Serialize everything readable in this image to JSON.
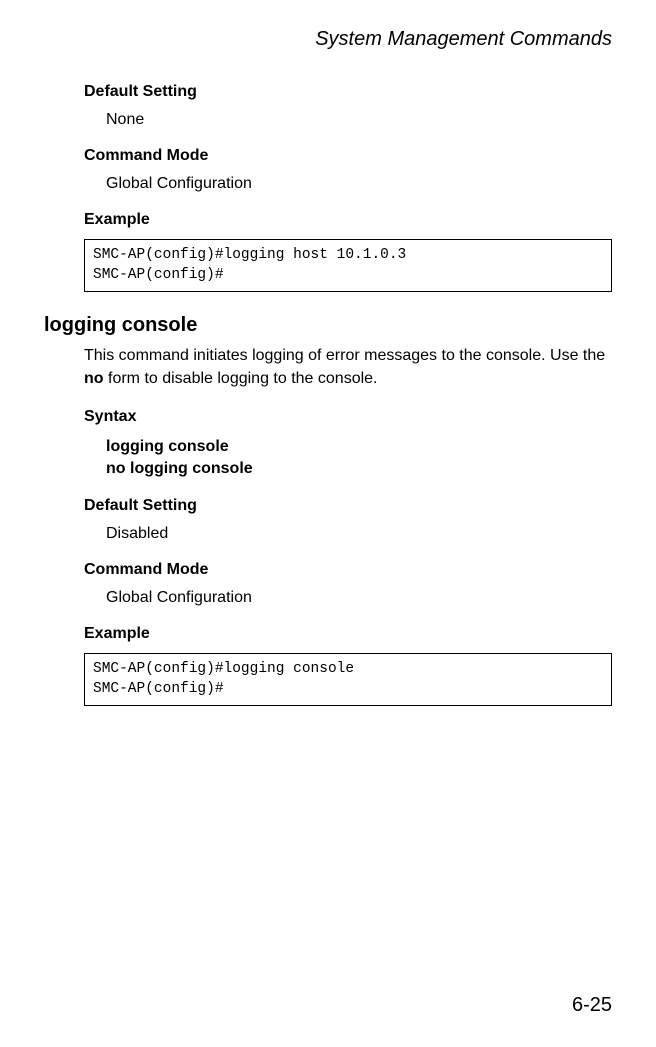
{
  "header": {
    "title": "System Management Commands"
  },
  "block1": {
    "default_setting_label": "Default Setting",
    "default_setting_value": "None",
    "command_mode_label": "Command Mode",
    "command_mode_value": "Global Configuration",
    "example_label": "Example",
    "example_code": "SMC-AP(config)#logging host 10.1.0.3\nSMC-AP(config)#"
  },
  "command": {
    "title": "logging console",
    "description_pre": "This command initiates logging of error messages to the console. Use the ",
    "description_bold": "no",
    "description_post": " form to disable logging to the console.",
    "syntax_label": "Syntax",
    "syntax_line1": "logging console",
    "syntax_line2": "no logging console",
    "default_setting_label": "Default Setting",
    "default_setting_value": "Disabled",
    "command_mode_label": "Command Mode",
    "command_mode_value": "Global Configuration",
    "example_label": "Example",
    "example_code": "SMC-AP(config)#logging console\nSMC-AP(config)#"
  },
  "page_number": "6-25"
}
